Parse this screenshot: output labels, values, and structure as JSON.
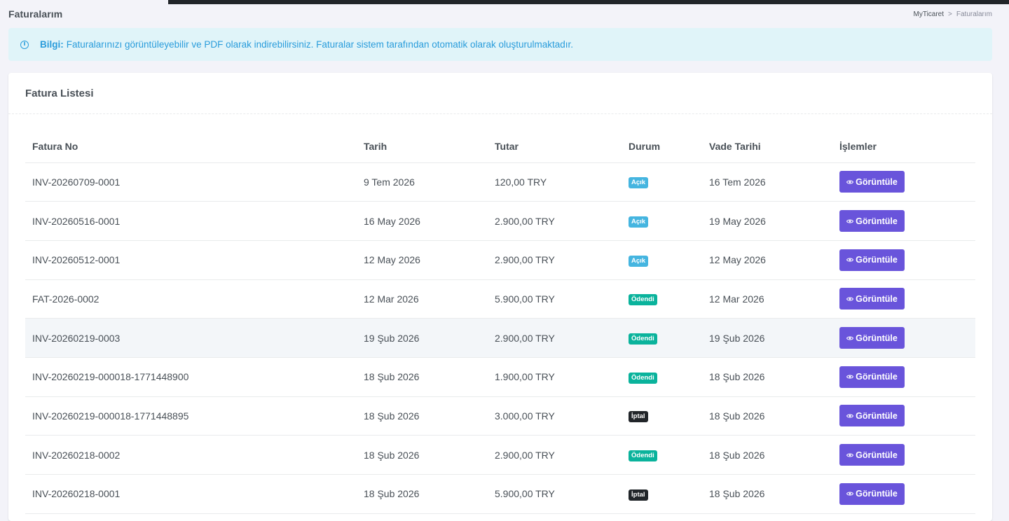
{
  "page": {
    "title": "Faturalarım",
    "breadcrumb": {
      "home": "MyTicaret",
      "separator": ">",
      "current": "Faturalarım"
    }
  },
  "alert": {
    "icon": "info-circle-icon",
    "strong": "Bilgi:",
    "text": "Faturalarınızı görüntüleyebilir ve PDF olarak indirebilirsiniz. Faturalar sistem tarafından otomatik olarak oluşturulmaktadır."
  },
  "card": {
    "title": "Fatura Listesi",
    "columns": [
      "Fatura No",
      "Tarih",
      "Tutar",
      "Durum",
      "Vade Tarihi",
      "İşlemler"
    ],
    "rows": [
      {
        "no": "INV-20260709-0001",
        "date": "9 Tem 2026",
        "amount": "120,00 TRY",
        "status": "Açık",
        "status_type": "open",
        "due": "16 Tem 2026",
        "action": "Görüntüle"
      },
      {
        "no": "INV-20260516-0001",
        "date": "16 May 2026",
        "amount": "2.900,00 TRY",
        "status": "Açık",
        "status_type": "open",
        "due": "19 May 2026",
        "action": "Görüntüle"
      },
      {
        "no": "INV-20260512-0001",
        "date": "12 May 2026",
        "amount": "2.900,00 TRY",
        "status": "Açık",
        "status_type": "open",
        "due": "12 May 2026",
        "action": "Görüntüle"
      },
      {
        "no": "FAT-2026-0002",
        "date": "12 Mar 2026",
        "amount": "5.900,00 TRY",
        "status": "Ödendi",
        "status_type": "paid",
        "due": "12 Mar 2026",
        "action": "Görüntüle"
      },
      {
        "no": "INV-20260219-0003",
        "date": "19 Şub 2026",
        "amount": "2.900,00 TRY",
        "status": "Ödendi",
        "status_type": "paid",
        "due": "19 Şub 2026",
        "action": "Görüntüle",
        "highlight": true
      },
      {
        "no": "INV-20260219-000018-1771448900",
        "date": "18 Şub 2026",
        "amount": "1.900,00 TRY",
        "status": "Ödendi",
        "status_type": "paid",
        "due": "18 Şub 2026",
        "action": "Görüntüle"
      },
      {
        "no": "INV-20260219-000018-1771448895",
        "date": "18 Şub 2026",
        "amount": "3.000,00 TRY",
        "status": "İptal",
        "status_type": "cancel",
        "due": "18 Şub 2026",
        "action": "Görüntüle"
      },
      {
        "no": "INV-20260218-0002",
        "date": "18 Şub 2026",
        "amount": "2.900,00 TRY",
        "status": "Ödendi",
        "status_type": "paid",
        "due": "18 Şub 2026",
        "action": "Görüntüle"
      },
      {
        "no": "INV-20260218-0001",
        "date": "18 Şub 2026",
        "amount": "5.900,00 TRY",
        "status": "İptal",
        "status_type": "cancel",
        "due": "18 Şub 2026",
        "action": "Görüntüle"
      }
    ]
  },
  "colors": {
    "primary": "#6954db",
    "status_open": "#45b5e0",
    "status_paid": "#0ab39c",
    "status_cancel": "#212529",
    "alert_bg": "#e0f4f9",
    "alert_text": "#299cdb"
  },
  "icons": {
    "view_button": "eye-icon"
  }
}
